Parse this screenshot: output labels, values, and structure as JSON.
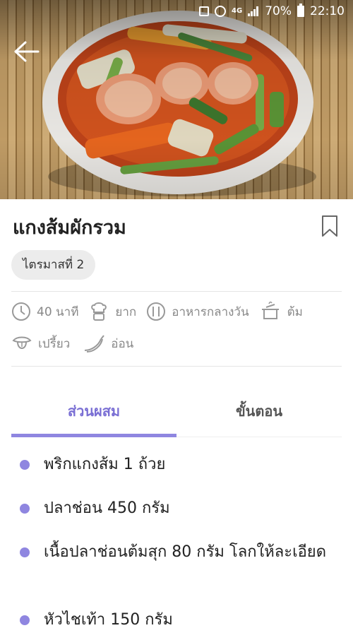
{
  "status_bar": {
    "network": "4G",
    "battery": "70%",
    "time": "22:10"
  },
  "recipe": {
    "title": "แกงส้มผักรวม",
    "tag": "ไตรมาสที่ 2",
    "meta": {
      "time": "40 นาที",
      "difficulty": "ยาก",
      "meal": "อาหารกลางวัน",
      "method": "ต้ม",
      "taste": "เปรี้ยว",
      "spice": "อ่อน"
    }
  },
  "tabs": {
    "ingredients": "ส่วนผสม",
    "steps": "ขั้นตอน"
  },
  "ingredients": [
    "พริกแกงส้ม 1 ถ้วย",
    "ปลาช่อน 450 กรัม",
    "เนื้อปลาช่อนต้มสุก 80 กรัม โลกให้ละเอียด",
    "หัวไชเท้า 150 กรัม"
  ],
  "colors": {
    "accent": "#8f86e0",
    "accent_text": "#7a6fd4",
    "tag_bg": "#ececec"
  }
}
